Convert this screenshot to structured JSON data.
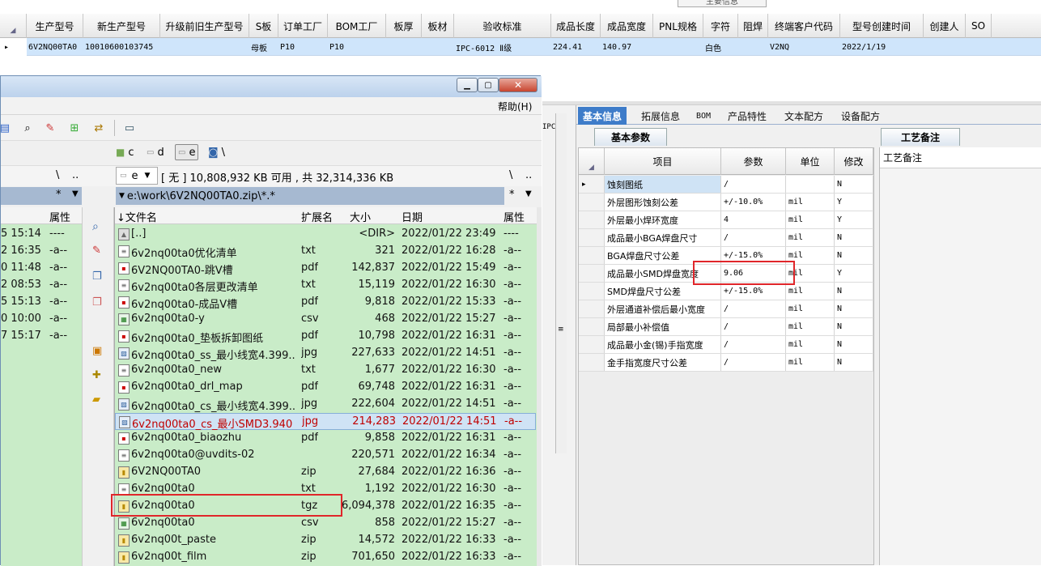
{
  "top_tab": "主要信息",
  "grid": {
    "columns": [
      "生产型号",
      "新生产型号",
      "升级前旧生产型号",
      "S板",
      "订单工厂",
      "BOM工厂",
      "板厚",
      "板材",
      "验收标准",
      "成品长度",
      "成品宽度",
      "PNL规格",
      "字符",
      "阻焊",
      "终端客户代码",
      "型号创建时间",
      "创建人",
      "SO"
    ],
    "row": {
      "col0": "6V2NQ00TA0",
      "col1": "10010600103745",
      "col3": "母板",
      "col4": "P10",
      "col5": "P10",
      "col8": "IPC-6012 Ⅱ级",
      "col9": "224.41",
      "col10": "140.97",
      "col12": "白色",
      "col14": "V2NQ",
      "col15": "2022/1/19"
    }
  },
  "right_tabs": [
    "基本信息",
    "拓展信息",
    "BOM",
    "产品特性",
    "文本配方",
    "设备配方"
  ],
  "params": {
    "tab": "基本参数",
    "headers": [
      "项目",
      "参数",
      "单位",
      "修改"
    ],
    "rows": [
      {
        "item": "蚀刻图纸",
        "value": "/",
        "unit": "",
        "mod": "N"
      },
      {
        "item": "外层图形蚀刻公差",
        "value": "+/-10.0%",
        "unit": "mil",
        "mod": "Y"
      },
      {
        "item": "外层最小焊环宽度",
        "value": "4",
        "unit": "mil",
        "mod": "Y"
      },
      {
        "item": "成品最小BGA焊盘尺寸",
        "value": "/",
        "unit": "mil",
        "mod": "N"
      },
      {
        "item": "BGA焊盘尺寸公差",
        "value": "+/-15.0%",
        "unit": "mil",
        "mod": "N"
      },
      {
        "item": "成品最小SMD焊盘宽度",
        "value": "9.06",
        "unit": "mil",
        "mod": "Y"
      },
      {
        "item": "SMD焊盘尺寸公差",
        "value": "+/-15.0%",
        "unit": "mil",
        "mod": "N"
      },
      {
        "item": "外层通道补偿后最小宽度",
        "value": "/",
        "unit": "mil",
        "mod": "N"
      },
      {
        "item": "局部最小补偿值",
        "value": "/",
        "unit": "mil",
        "mod": "N"
      },
      {
        "item": "成品最小金(锡)手指宽度",
        "value": "/",
        "unit": "mil",
        "mod": "N"
      },
      {
        "item": "金手指宽度尺寸公差",
        "value": "/",
        "unit": "mil",
        "mod": "N"
      }
    ]
  },
  "notes": {
    "tab": "工艺备注",
    "header": "工艺备注"
  },
  "fm": {
    "menu_help": "帮助(H)",
    "drives": [
      "c",
      "d",
      "e",
      "\\"
    ],
    "drive_sel": "e",
    "free_info": "[ 无 ]  10,808,932 KB 可用 , 共 32,314,336 KB",
    "path": "e:\\work\\6V2NQ00TA0.zip\\*.*",
    "star": "*",
    "back": "\\",
    "dots": "..",
    "headers": [
      "文件名",
      "扩展名",
      "大小",
      "日期",
      "属性"
    ],
    "left_header": "属性",
    "left_rows": [
      {
        "date": "5 15:14",
        "attr": "----"
      },
      {
        "date": "2 16:35",
        "attr": "-a--"
      },
      {
        "date": "0 11:48",
        "attr": "-a--"
      },
      {
        "date": "2 08:53",
        "attr": "-a--"
      },
      {
        "date": "5 15:13",
        "attr": "-a--"
      },
      {
        "date": "0 10:00",
        "attr": "-a--"
      },
      {
        "date": "7 15:17",
        "attr": "-a--"
      }
    ],
    "files": [
      {
        "name": "[..]",
        "ext": "",
        "size": "<DIR>",
        "date": "2022/01/22 23:49",
        "attr": "----",
        "icon": "up"
      },
      {
        "name": "6v2nq00ta0优化清单",
        "ext": "txt",
        "size": "321",
        "date": "2022/01/22 16:28",
        "attr": "-a--",
        "icon": "txt"
      },
      {
        "name": "6V2NQ00TA0-跳V槽",
        "ext": "pdf",
        "size": "142,837",
        "date": "2022/01/22 15:49",
        "attr": "-a--",
        "icon": "pdf"
      },
      {
        "name": "6v2nq00ta0各层更改清单",
        "ext": "txt",
        "size": "15,119",
        "date": "2022/01/22 16:30",
        "attr": "-a--",
        "icon": "txt"
      },
      {
        "name": "6v2nq00ta0-成品V槽",
        "ext": "pdf",
        "size": "9,818",
        "date": "2022/01/22 15:33",
        "attr": "-a--",
        "icon": "pdf"
      },
      {
        "name": "6v2nq00ta0-y",
        "ext": "csv",
        "size": "468",
        "date": "2022/01/22 15:27",
        "attr": "-a--",
        "icon": "csv"
      },
      {
        "name": "6v2nq00ta0_垫板拆卸图纸",
        "ext": "pdf",
        "size": "10,798",
        "date": "2022/01/22 16:31",
        "attr": "-a--",
        "icon": "pdf"
      },
      {
        "name": "6v2nq00ta0_ss_最小线宽4.399..",
        "ext": "jpg",
        "size": "227,633",
        "date": "2022/01/22 14:51",
        "attr": "-a--",
        "icon": "jpg"
      },
      {
        "name": "6v2nq00ta0_new",
        "ext": "txt",
        "size": "1,677",
        "date": "2022/01/22 16:30",
        "attr": "-a--",
        "icon": "txt"
      },
      {
        "name": "6v2nq00ta0_drl_map",
        "ext": "pdf",
        "size": "69,748",
        "date": "2022/01/22 16:31",
        "attr": "-a--",
        "icon": "pdf"
      },
      {
        "name": "6v2nq00ta0_cs_最小线宽4.399..",
        "ext": "jpg",
        "size": "222,604",
        "date": "2022/01/22 14:51",
        "attr": "-a--",
        "icon": "jpg"
      },
      {
        "name": "6v2nq00ta0_cs_最小SMD3.940",
        "ext": "jpg",
        "size": "214,283",
        "date": "2022/01/22 14:51",
        "attr": "-a--",
        "icon": "jpg",
        "selected": true
      },
      {
        "name": "6v2nq00ta0_biaozhu",
        "ext": "pdf",
        "size": "9,858",
        "date": "2022/01/22 16:31",
        "attr": "-a--",
        "icon": "pdf"
      },
      {
        "name": "6v2nq00ta0@uvdits-02",
        "ext": "",
        "size": "220,571",
        "date": "2022/01/22 16:34",
        "attr": "-a--",
        "icon": "txt"
      },
      {
        "name": "6V2NQ00TA0",
        "ext": "zip",
        "size": "27,684",
        "date": "2022/01/22 16:36",
        "attr": "-a--",
        "icon": "zip"
      },
      {
        "name": "6v2nq00ta0",
        "ext": "txt",
        "size": "1,192",
        "date": "2022/01/22 16:30",
        "attr": "-a--",
        "icon": "txt"
      },
      {
        "name": "6v2nq00ta0",
        "ext": "tgz",
        "size": "6,094,378",
        "date": "2022/01/22 16:35",
        "attr": "-a--",
        "icon": "zip"
      },
      {
        "name": "6v2nq00ta0",
        "ext": "csv",
        "size": "858",
        "date": "2022/01/22 15:27",
        "attr": "-a--",
        "icon": "csv"
      },
      {
        "name": "6v2nq00t_paste",
        "ext": "zip",
        "size": "14,572",
        "date": "2022/01/22 16:33",
        "attr": "-a--",
        "icon": "zip"
      },
      {
        "name": "6v2nq00t_film",
        "ext": "zip",
        "size": "701,650",
        "date": "2022/01/22 16:33",
        "attr": "-a--",
        "icon": "zip"
      }
    ]
  },
  "ipc_fragment": "IPC"
}
